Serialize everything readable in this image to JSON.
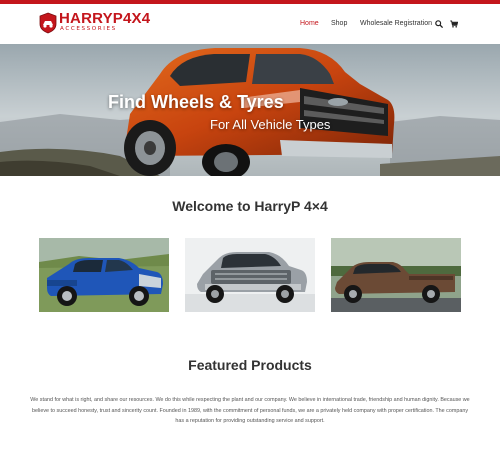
{
  "brand": {
    "name": "HARRYP4X4",
    "tagline": "ACCESSORIES",
    "accent": "#c4161c"
  },
  "nav": {
    "items": [
      {
        "label": "Home",
        "active": true
      },
      {
        "label": "Shop",
        "active": false
      },
      {
        "label": "Wholesale Registration",
        "active": false
      }
    ],
    "icons": [
      "search-icon",
      "cart-icon"
    ]
  },
  "hero": {
    "title": "Find Wheels & Tyres",
    "subtitle": "For All Vehicle Types"
  },
  "welcome": {
    "heading": "Welcome to HarryP 4×4"
  },
  "gallery": {
    "items": [
      {
        "name": "blue-pickup-truck",
        "color": "#1f56b8"
      },
      {
        "name": "silver-pickup-truck",
        "color": "#9aa0a6"
      },
      {
        "name": "bronze-pickup-truck",
        "color": "#6b4a35"
      }
    ]
  },
  "featured": {
    "heading": "Featured Products",
    "text": "We stand for what is right, and share our resources. We do this while respecting the plant and our company. We believe in international trade, friendship and human dignity. Because we believe to succeed honesty, trust and sincerity count. Founded in 1989, with the commitment of personal funds, we are a privately held company with proper certification. The company has a reputation for providing outstanding service and support."
  }
}
